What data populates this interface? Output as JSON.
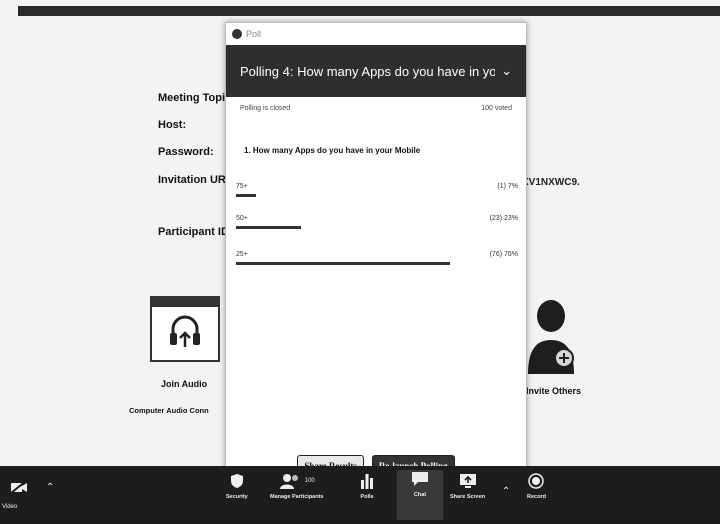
{
  "meeting_info": {
    "topic_label": "Meeting Topi",
    "host_label": "Host:",
    "password_label": "Password:",
    "invitation_label": "Invitation UR",
    "invitation_tail": "XV1NXWC9.",
    "participant_label": "Participant ID"
  },
  "tiles": {
    "join_audio": "Join Audio",
    "computer_audio": "Computer Audio Conn",
    "invite_others": "Invite Others"
  },
  "poll": {
    "window_title": "Poll",
    "header_title": "Polling 4: How many Apps do you have in you...",
    "status": "Polling is closed",
    "voted": "100 voted",
    "question": "1. How many Apps do you have in your Mobile",
    "answers": [
      {
        "label": "75+",
        "result": "(1) 7%",
        "fraction": 0.07
      },
      {
        "label": "50+",
        "result": "(23) 23%",
        "fraction": 0.23
      },
      {
        "label": "25+",
        "result": "(76) 76%",
        "fraction": 0.76
      }
    ],
    "share_button": "Share Results",
    "relaunch_button": "Re-launch Polling"
  },
  "toolbar": {
    "mic_label": "Video",
    "security": "Security",
    "manage_participants": "Manage Participants",
    "participant_count": "100",
    "polls": "Polls",
    "chat": "Chat",
    "share_screen": "Share Screen",
    "record": "Record"
  }
}
